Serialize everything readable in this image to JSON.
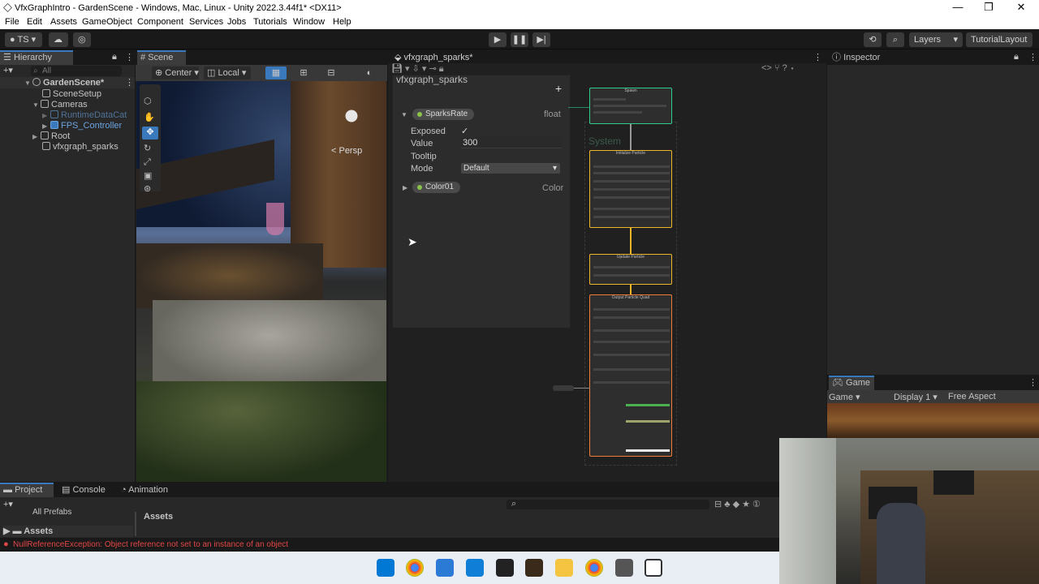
{
  "window": {
    "title": "VfxGraphIntro - GardenScene - Windows, Mac, Linux - Unity 2022.3.44f1* <DX11>",
    "controls": {
      "minimize": "—",
      "restore": "❐",
      "close": "✕"
    }
  },
  "menu": [
    "File",
    "Edit",
    "Assets",
    "GameObject",
    "Component",
    "Services",
    "Jobs",
    "Tutorials",
    "Window",
    "Help"
  ],
  "toolbar": {
    "account": "TS",
    "layers": "Layers",
    "layout": "TutorialLayout"
  },
  "hierarchy": {
    "tab": "Hierarchy",
    "search_placeholder": "All",
    "items": [
      {
        "label": "GardenScene*",
        "bold": true
      },
      {
        "label": "SceneSetup"
      },
      {
        "label": "Cameras"
      },
      {
        "label": "RuntimeDataCat"
      },
      {
        "label": "FPS_Controller"
      },
      {
        "label": "Root"
      },
      {
        "label": "vfxgraph_sparks"
      }
    ]
  },
  "scene": {
    "tab": "Scene",
    "pivot": "Center",
    "space": "Local",
    "view_label": "< Persp"
  },
  "vfx": {
    "tab": "vfxgraph_sparks*",
    "blackboard_title": "vfxgraph_sparks",
    "add_button": "+",
    "properties": [
      {
        "name": "SparksRate",
        "type": "float"
      },
      {
        "name": "Color01",
        "type": "Color"
      }
    ],
    "fields": {
      "exposed_label": "Exposed",
      "exposed_value": "✓",
      "value_label": "Value",
      "value": "300",
      "tooltip_label": "Tooltip",
      "mode_label": "Mode",
      "mode_value": "Default"
    },
    "nodes": {
      "spawn": "Spawn",
      "system": "System",
      "initialize": "Initialize Particle",
      "update": "Update Particle",
      "output": "Output Particle Quad"
    }
  },
  "inspector": {
    "tab": "Inspector"
  },
  "game": {
    "tab": "Game",
    "mode": "Game",
    "display": "Display 1",
    "aspect": "Free Aspect"
  },
  "bottom": {
    "tabs": [
      "Project",
      "Console",
      "Animation"
    ],
    "left_item": "All Prefabs",
    "left_folder": "Assets",
    "breadcrumb": "Assets",
    "error": "NullReferenceException: Object reference not set to an instance of an object"
  },
  "colors": {
    "accent": "#3a79bb",
    "spawn": "#2ecc8f",
    "init": "#f0b429",
    "output": "#f07c3a",
    "error": "#e24646"
  }
}
